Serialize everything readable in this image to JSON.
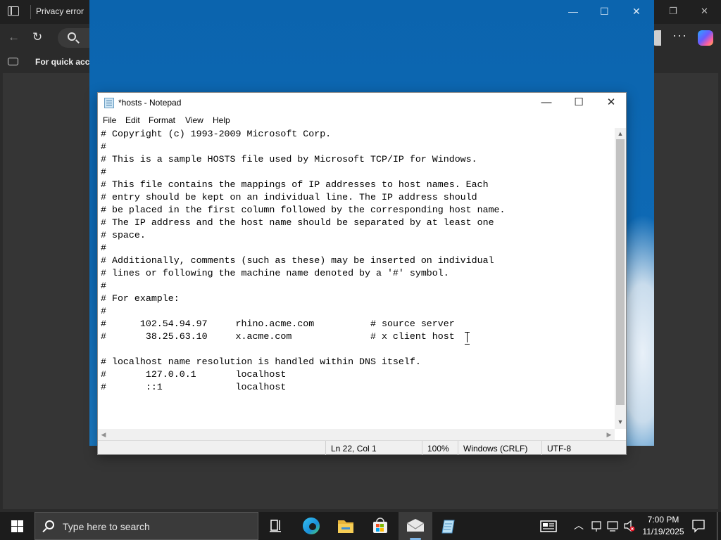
{
  "browser": {
    "tab_title": "Privacy error",
    "favorites_text": "For quick acce",
    "min_glyph": "—",
    "restore_glyph": "❐",
    "close_glyph": "✕",
    "back_glyph": "←",
    "reload_glyph": "↻",
    "more_glyph": "···"
  },
  "remote": {
    "min_glyph": "—",
    "max_glyph": "☐",
    "close_glyph": "✕"
  },
  "notepad": {
    "title": "*hosts - Notepad",
    "min_glyph": "—",
    "max_glyph": "☐",
    "close_glyph": "✕",
    "menu": [
      "File",
      "Edit",
      "Format",
      "View",
      "Help"
    ],
    "lines": [
      "# Copyright (c) 1993-2009 Microsoft Corp.",
      "#",
      "# This is a sample HOSTS file used by Microsoft TCP/IP for Windows.",
      "#",
      "# This file contains the mappings of IP addresses to host names. Each",
      "# entry should be kept on an individual line. The IP address should",
      "# be placed in the first column followed by the corresponding host name.",
      "# The IP address and the host name should be separated by at least one",
      "# space.",
      "#",
      "# Additionally, comments (such as these) may be inserted on individual",
      "# lines or following the machine name denoted by a '#' symbol.",
      "#",
      "# For example:",
      "#",
      "#      102.54.94.97     rhino.acme.com          # source server",
      "#       38.25.63.10     x.acme.com              # x client host",
      "",
      "# localhost name resolution is handled within DNS itself.",
      "#       127.0.0.1       localhost",
      "#       ::1             localhost"
    ],
    "scroll_up": "▲",
    "scroll_down": "▼",
    "scroll_left": "◀",
    "scroll_right": "▶",
    "status": {
      "position": "Ln 22, Col 1",
      "zoom": "100%",
      "line_ending": "Windows (CRLF)",
      "encoding": "UTF-8"
    }
  },
  "taskbar": {
    "search_placeholder": "Type here to search",
    "time": "7:00 PM",
    "date": "11/19/2025",
    "tray_chevron": "︿"
  },
  "icons": {
    "start": "windows-logo-icon",
    "task_view": "task-view-icon",
    "edge": "edge-icon",
    "explorer": "file-explorer-icon",
    "store": "store-icon",
    "remote": "remote-desktop-icon",
    "notepad": "notepad-icon"
  }
}
